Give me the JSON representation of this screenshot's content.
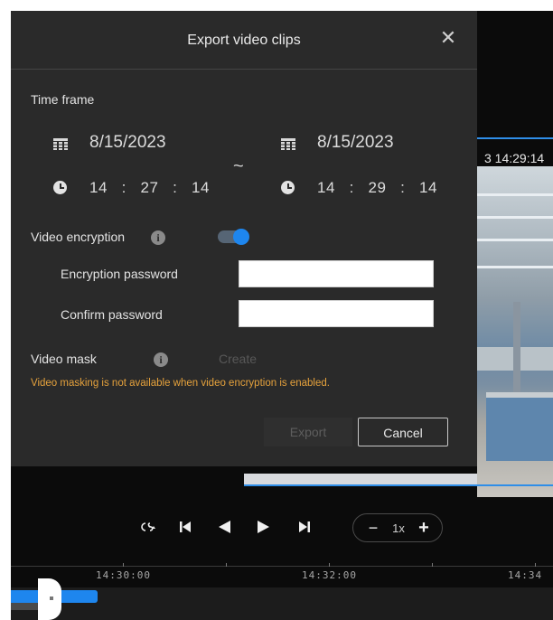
{
  "dialog": {
    "title": "Export video clips",
    "close_symbol": "✕",
    "time_frame_label": "Time frame",
    "start": {
      "date": "8/15/2023",
      "hh": "14",
      "mm": "27",
      "ss": "14"
    },
    "end": {
      "date": "8/15/2023",
      "hh": "14",
      "mm": "29",
      "ss": "14"
    },
    "range_separator": "~",
    "time_separator": ":",
    "encryption": {
      "label": "Video encryption",
      "enabled": true,
      "password_label": "Encryption password",
      "confirm_label": "Confirm password",
      "password_value": "",
      "confirm_value": ""
    },
    "mask": {
      "label": "Video mask",
      "create_label": "Create",
      "warning": "Video masking is not available when video encryption is enabled."
    },
    "buttons": {
      "export": "Export",
      "cancel": "Cancel"
    }
  },
  "camera": {
    "timestamp_partial": "3 14:29:14"
  },
  "playback": {
    "speed": "1x",
    "speed_minus": "−",
    "speed_plus": "+"
  },
  "timeline": {
    "labels": [
      "14:30:00",
      "14:32:00",
      "14:34"
    ]
  },
  "icons": {
    "calendar": "calendar-icon",
    "clock": "clock-icon",
    "info": "info-icon",
    "close": "close-icon",
    "sync": "sync-icon",
    "skip_start": "skip-to-start-icon",
    "step_back": "step-back-icon",
    "play": "play-icon",
    "skip_end": "skip-to-end-icon"
  },
  "colors": {
    "accent": "#1e86ee",
    "warning": "#e6a23c",
    "dialog_bg": "#2a2a2a"
  }
}
